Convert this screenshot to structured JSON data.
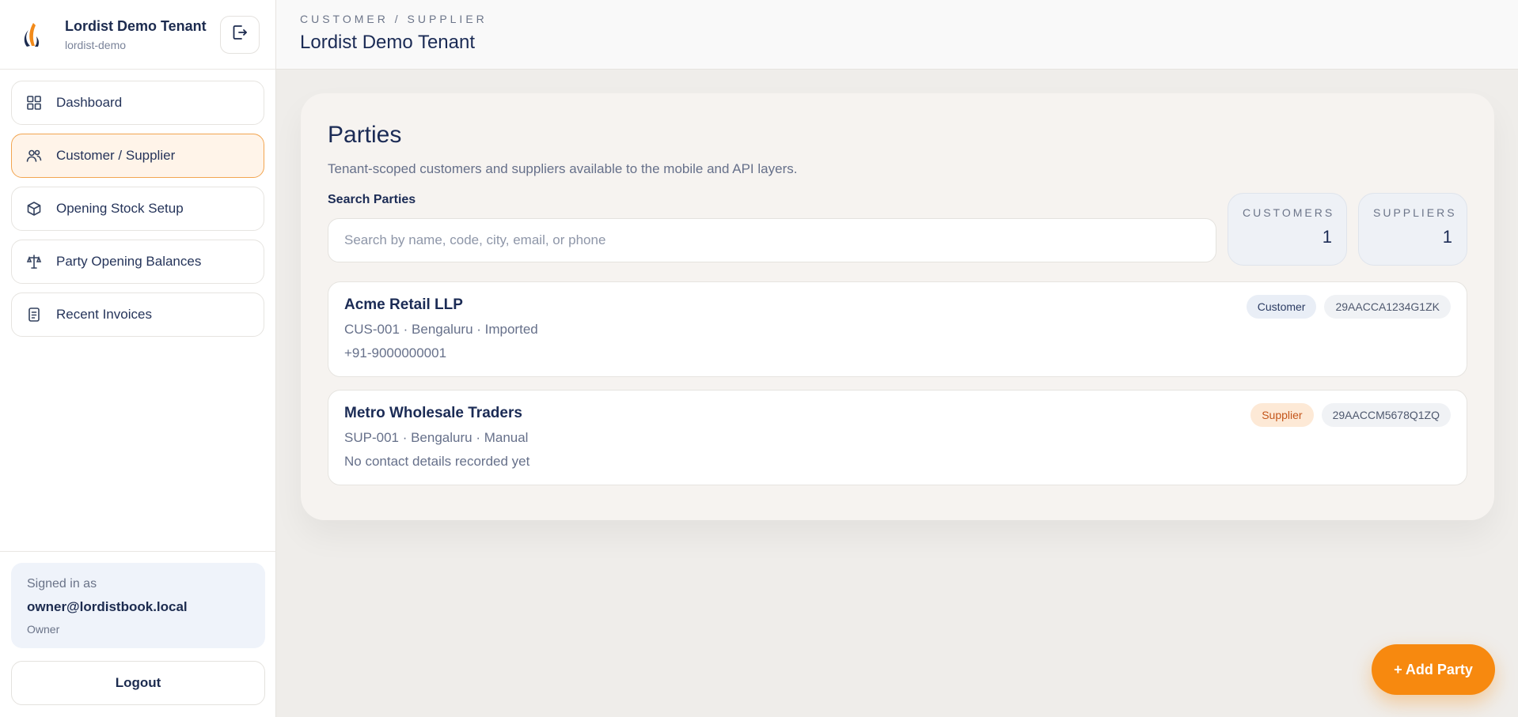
{
  "tenant": {
    "name": "Lordist Demo Tenant",
    "slug": "lordist-demo"
  },
  "sidebar": {
    "items": [
      {
        "label": "Dashboard",
        "icon": "grid-icon",
        "active": false
      },
      {
        "label": "Customer / Supplier",
        "icon": "users-icon",
        "active": true
      },
      {
        "label": "Opening Stock Setup",
        "icon": "box-icon",
        "active": false
      },
      {
        "label": "Party Opening Balances",
        "icon": "balance-icon",
        "active": false
      },
      {
        "label": "Recent Invoices",
        "icon": "invoice-icon",
        "active": false
      }
    ],
    "signed_in_label": "Signed in as",
    "email": "owner@lordistbook.local",
    "role": "Owner",
    "logout_label": "Logout"
  },
  "header": {
    "breadcrumb": "CUSTOMER / SUPPLIER",
    "title": "Lordist Demo Tenant"
  },
  "main": {
    "title": "Parties",
    "description": "Tenant-scoped customers and suppliers available to the mobile and API layers.",
    "search_label": "Search Parties",
    "search_placeholder": "Search by name, code, city, email, or phone",
    "search_value": "",
    "stats": {
      "customers_label": "CUSTOMERS",
      "customers_value": "1",
      "suppliers_label": "SUPPLIERS",
      "suppliers_value": "1"
    },
    "parties": [
      {
        "name": "Acme Retail LLP",
        "meta": "CUS-001 · Bengaluru · Imported",
        "contact": "+91-9000000001",
        "type": "Customer",
        "gstin": "29AACCA1234G1ZK"
      },
      {
        "name": "Metro Wholesale Traders",
        "meta": "SUP-001 · Bengaluru · Manual",
        "contact": "No contact details recorded yet",
        "type": "Supplier",
        "gstin": "29AACCM5678Q1ZQ"
      }
    ],
    "add_button": "+ Add Party"
  },
  "colors": {
    "accent": "#f7890f",
    "active_bg": "#fff4e9",
    "active_border": "#f2a550",
    "text_primary": "#1b2b55"
  }
}
